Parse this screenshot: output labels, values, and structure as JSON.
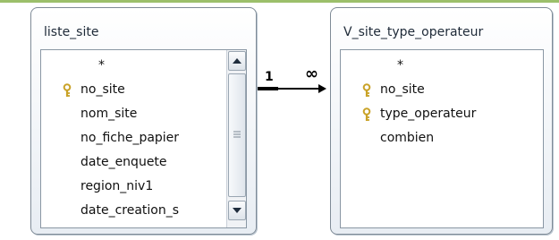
{
  "tables": [
    {
      "title": "liste_site",
      "fields": [
        {
          "name": "*",
          "key": false
        },
        {
          "name": "no_site",
          "key": true
        },
        {
          "name": "nom_site",
          "key": false
        },
        {
          "name": "no_fiche_papier",
          "key": false
        },
        {
          "name": "date_enquete",
          "key": false
        },
        {
          "name": "region_niv1",
          "key": false
        },
        {
          "name": "date_creation_s",
          "key": false
        }
      ],
      "has_scrollbar": true
    },
    {
      "title": "V_site_type_operateur",
      "fields": [
        {
          "name": "*",
          "key": false
        },
        {
          "name": "no_site",
          "key": true
        },
        {
          "name": "type_operateur",
          "key": true
        },
        {
          "name": "combien",
          "key": false
        }
      ],
      "has_scrollbar": false
    }
  ],
  "relationship": {
    "one_side_label": "1",
    "many_side_label": "∞"
  },
  "icons": {
    "primary_key": "key-icon",
    "scroll_up": "arrow-up-icon",
    "scroll_down": "arrow-down-icon",
    "scroll_grip": "grip-icon",
    "arrowhead": "arrowhead-icon"
  },
  "colors": {
    "key_gold": "#c9a227",
    "border": "#7f8b97",
    "accent_green": "#8db45a"
  }
}
